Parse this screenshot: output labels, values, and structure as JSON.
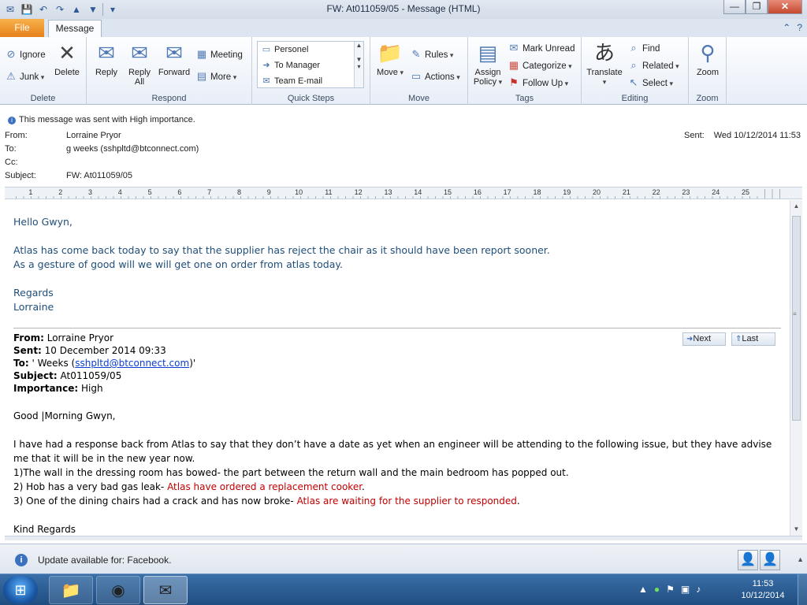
{
  "window": {
    "title": "FW: At011059/05  -  Message (HTML)",
    "controls": {
      "minimize": "—",
      "maximize": "❐",
      "close": "✕"
    }
  },
  "qat_icons": [
    "save-icon",
    "undo-icon",
    "redo-icon",
    "up-arrow-icon",
    "down-arrow-icon",
    "customize-icon"
  ],
  "tabs": {
    "file": "File",
    "message": "Message"
  },
  "ribbon": {
    "delete": {
      "label": "Delete",
      "ignore": "Ignore",
      "junk": "Junk",
      "delete_btn": "Delete"
    },
    "respond": {
      "label": "Respond",
      "reply": "Reply",
      "reply_all_1": "Reply",
      "reply_all_2": "All",
      "forward": "Forward",
      "meeting": "Meeting",
      "more": "More"
    },
    "quick_steps": {
      "label": "Quick Steps",
      "items": [
        "Personel",
        "To Manager",
        "Team E-mail"
      ]
    },
    "move": {
      "label": "Move",
      "move_btn": "Move",
      "rules": "Rules",
      "actions": "Actions"
    },
    "tags": {
      "label": "Tags",
      "assign_policy_1": "Assign",
      "assign_policy_2": "Policy",
      "mark_unread": "Mark Unread",
      "categorize": "Categorize",
      "follow_up": "Follow Up"
    },
    "editing": {
      "label": "Editing",
      "translate": "Translate",
      "find": "Find",
      "related": "Related",
      "select": "Select"
    },
    "zoom": {
      "label": "Zoom",
      "zoom_btn": "Zoom"
    }
  },
  "header": {
    "importance_note": "This message was sent with High importance.",
    "from_label": "From:",
    "from": "Lorraine Pryor",
    "to_label": "To:",
    "to": "g weeks (sshpltd@btconnect.com)",
    "cc_label": "Cc:",
    "cc": "",
    "subject_label": "Subject:",
    "subject": "FW: At011059/05",
    "sent_label": "Sent:",
    "sent": "Wed 10/12/2014 11:53"
  },
  "ruler_numbers": [
    "1",
    "2",
    "3",
    "4",
    "5",
    "6",
    "7",
    "8",
    "9",
    "10",
    "11",
    "12",
    "13",
    "14",
    "15",
    "16",
    "17",
    "18",
    "19",
    "20",
    "21",
    "22",
    "23",
    "24",
    "25"
  ],
  "body": {
    "greeting": "Hello Gwyn,",
    "line1": "Atlas has come back today to say that the supplier has reject the chair as it should have been report sooner.",
    "line2": "As a gesture of good will we will get one on order from atlas today.",
    "regards": "Regards",
    "signature": "Lorraine",
    "fwd": {
      "from_label": "From:",
      "from": " Lorraine Pryor",
      "sent_label": "Sent:",
      "sent": " 10 December 2014 09:33",
      "to_label": "To:",
      "to_prefix": " ' Weeks (",
      "to_email": "sshpltd@btconnect.com",
      "to_suffix": ")'",
      "subject_label": "Subject:",
      "subject": " At011059/05",
      "importance_label": "Importance:",
      "importance": " High",
      "next_btn": "Next",
      "last_btn": "Last",
      "greeting": "Good |Morning Gwyn,",
      "para1a": "I have had a response back from Atlas to say that they don’t have a date as yet when an engineer will be attending to the following issue, but they have advise",
      "para1b": "me that it will be in the new year now.",
      "item1": "1)The wall in the dressing room has bowed- the part between the return wall and the main bedroom has popped out.",
      "item2_black": "2) Hob has a very bad gas leak- ",
      "item2_red": "Atlas have ordered a replacement cooker",
      "item2_end": ".",
      "item3_black": "3) One of the dining chairs had a crack and has now broke- ",
      "item3_red": "Atlas are waiting for the supplier to responded",
      "item3_end": ".",
      "closing": "Kind Regards"
    }
  },
  "infobar": {
    "text": "Update available for: Facebook."
  },
  "taskbar": {
    "apps": [
      "explorer-icon",
      "chrome-icon",
      "outlook-icon"
    ],
    "clock_time": "11:53",
    "clock_date": "10/12/2014"
  },
  "colors": {
    "body_blue": "#1f4e79",
    "red": "#c00000",
    "file_tab": "#e7801a"
  }
}
